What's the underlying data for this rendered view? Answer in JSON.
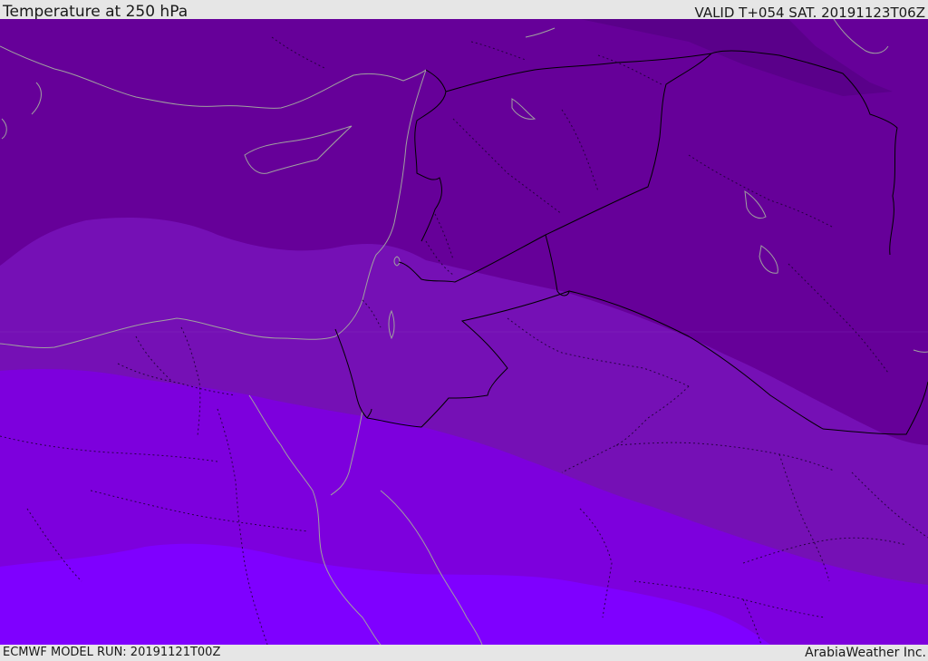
{
  "header": {
    "title": "Temperature at 250 hPa",
    "valid_time": "VALID T+054 SAT. 20191123T06Z"
  },
  "footer": {
    "model_run": "ECMWF MODEL RUN: 20191121T00Z",
    "credit": "ArabiaWeather Inc."
  },
  "map": {
    "region": "Eastern Mediterranean / Levant / Egypt / Iraq",
    "bands": [
      {
        "color": "#660099",
        "level": 1
      },
      {
        "color": "#7510b5",
        "level": 2
      },
      {
        "color": "#7d00dd",
        "level": 3
      },
      {
        "color": "#7f00ff",
        "level": 4
      }
    ],
    "band_cold": "#660099",
    "band_cold2": "#5f0092",
    "band_mid": "#7510b5",
    "band_warm": "#7d00dd",
    "band_warmest": "#7f00ff",
    "coastline_color": "#a0a0a0",
    "border_color": "#000000"
  }
}
